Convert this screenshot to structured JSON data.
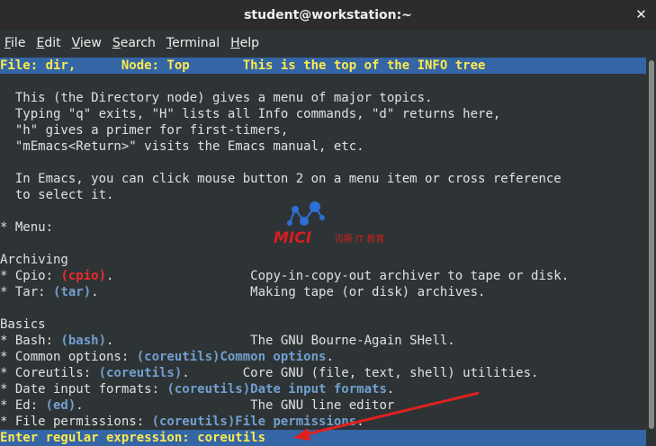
{
  "window": {
    "title": "student@workstation:~"
  },
  "menu": [
    {
      "ul": "F",
      "rest": "ile"
    },
    {
      "ul": "E",
      "rest": "dit"
    },
    {
      "ul": "V",
      "rest": "iew"
    },
    {
      "ul": "S",
      "rest": "earch"
    },
    {
      "ul": "T",
      "rest": "erminal"
    },
    {
      "ul": "H",
      "rest": "elp"
    }
  ],
  "info": {
    "header": "File: dir,      Node: Top       This is the top of the INFO tree",
    "intro": [
      "  This (the Directory node) gives a menu of major topics.",
      "  Typing \"q\" exits, \"H\" lists all Info commands, \"d\" returns here,",
      "  \"h\" gives a primer for first-timers,",
      "  \"mEmacs<Return>\" visits the Emacs manual, etc."
    ],
    "emacs": [
      "  In Emacs, you can click mouse button 2 on a menu item or cross reference",
      "  to select it."
    ],
    "menu_label": "* Menu:",
    "archiving": {
      "heading": "Archiving",
      "cpio": {
        "pre": "* Cpio: ",
        "ref": "(cpio)",
        "post": ".                  Copy-in-copy-out archiver to tape or disk."
      },
      "tar": {
        "pre": "* Tar: ",
        "ref": "(tar)",
        "post": ".                    Making tape (or disk) archives."
      }
    },
    "basics": {
      "heading": "Basics",
      "bash": {
        "pre": "* Bash: ",
        "ref": "(bash)",
        "post": ".                  The GNU Bourne-Again SHell."
      },
      "common": {
        "pre": "* Common options: ",
        "ref": "(coreutils)Common options",
        "post": "."
      },
      "coreutils": {
        "pre": "* Coreutils: ",
        "ref": "(coreutils)",
        "post": ".       Core GNU (file, text, shell) utilities."
      },
      "date": {
        "pre": "* Date input formats: ",
        "ref": "(coreutils)Date input formats",
        "post": "."
      },
      "ed": {
        "pre": "* Ed: ",
        "ref": "(ed)",
        "post": ".                      The GNU line editor"
      },
      "perms": {
        "pre": "* File permissions: ",
        "ref": "(coreutils)File permissions",
        "post": "."
      }
    },
    "minibuffer": "Enter regular expression: coreutils"
  },
  "watermark": {
    "brand": "MICI",
    "cn": "迈斯 IT 教育"
  },
  "colors": {
    "header_bg": "#3465a4",
    "header_fg": "#fce94f",
    "ref": "#729fcf",
    "ref_red": "#ef2929",
    "arrow": "#e02020"
  }
}
